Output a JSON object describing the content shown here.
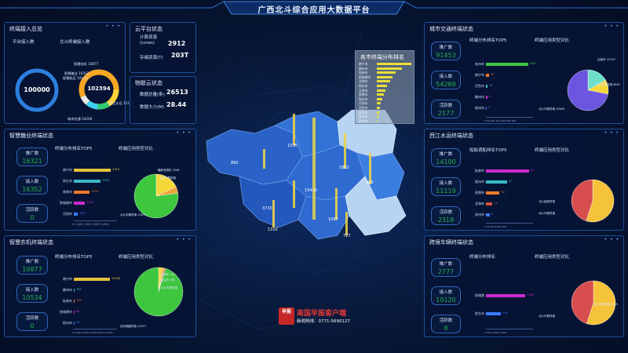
{
  "header": {
    "title": "广西北斗综合应用大数据平台"
  },
  "panel_dots": "• • •",
  "access": {
    "title": "终端接入总览",
    "platform_label": "平台接入数",
    "beidou_label": "北斗终端接入数",
    "platform_value": "100000",
    "beidou_value": "102394",
    "donut_labels": [
      "智慧农机 10877",
      "智慧糖业 16352",
      "智慧航运 10120",
      "西江水运 11119",
      "城市交通 54269"
    ]
  },
  "cloud": {
    "title": "云平台状态",
    "rows": [
      {
        "label": "计算资源(cores)",
        "value": "2912"
      },
      {
        "label": "存储资源(T)",
        "value": "203T"
      }
    ]
  },
  "iot": {
    "title": "物联云状态",
    "rows": [
      {
        "label": "数据总量(条)",
        "value": "26513"
      },
      {
        "label": "数据大小(M)",
        "value": "28.44"
      }
    ]
  },
  "sugar": {
    "title": "智慧糖业终端状态",
    "bar_title": "终端分布排名TOP5",
    "pie_title": "终端应用类型对比",
    "metrics": [
      {
        "label": "推广数",
        "value": "16321"
      },
      {
        "label": "接入数",
        "value": "16352"
      },
      {
        "label": "活跃数",
        "value": "0"
      }
    ],
    "ticks": "0  1,000  2,000  3,000  4,000",
    "pie_labels": [
      "糖蔗收割机 2946",
      "北斗车载终端",
      "北斗车载终端 12672"
    ]
  },
  "farm": {
    "title": "智慧农机终端状态",
    "bar_title": "终端分布排名TOP5",
    "pie_title": "终端应用类型对比",
    "metrics": [
      {
        "label": "推广数",
        "value": "10877"
      },
      {
        "label": "接入数",
        "value": "10534"
      },
      {
        "label": "活跃数",
        "value": "0"
      }
    ],
    "ticks": "0  2,000  4,000  6,000  8,000  10,000",
    "pie_labels": [
      "插秧机 281",
      "植保无人机",
      "北斗车载终端",
      "农机调度终端 10077"
    ]
  },
  "traffic": {
    "title": "城市交通终端状态",
    "bar_title": "终端分布排名TOP5",
    "pie_title": "终端应用类型对比",
    "metrics": [
      {
        "label": "推广数",
        "value": "91453"
      },
      {
        "label": "接入数",
        "value": "54269"
      },
      {
        "label": "活跃数",
        "value": "2177"
      }
    ],
    "ticks": "0  50  100  150  200  250  300",
    "pie_labels": [
      "出租车 10135",
      "北斗车载终端 6851",
      "北斗车载终端 43640"
    ]
  },
  "river": {
    "title": "西江水运终端状态",
    "bar_title": "船舶调船排名TOP5",
    "pie_title": "终端应用类型对比",
    "metrics": [
      {
        "label": "推广数",
        "value": "14100"
      },
      {
        "label": "接入数",
        "value": "11119"
      },
      {
        "label": "活跃数",
        "value": "2318"
      }
    ],
    "ticks": "0  20  40  60  80  100",
    "pie_labels": [
      "北斗船舶终端",
      "北斗车载终端"
    ]
  },
  "cross": {
    "title": "跨境车辆终端状态",
    "bar_title": "终端分布排名",
    "pie_title": "终端应用类型对比",
    "metrics": [
      {
        "label": "推广数",
        "value": "2777"
      },
      {
        "label": "接入数",
        "value": "10120"
      },
      {
        "label": "活跃数",
        "value": "8"
      }
    ],
    "ticks": "0  500  1,000  1,500",
    "pie_labels": [
      "北斗车载终端 2945",
      "北斗车载终端"
    ]
  },
  "map_popup": {
    "title": "各市终端分布排名",
    "items": [
      {
        "name": "南宁市",
        "v": 1.0
      },
      {
        "name": "柳州市",
        "v": 0.72
      },
      {
        "name": "桂林市",
        "v": 0.55
      },
      {
        "name": "防城港市",
        "v": 0.45
      },
      {
        "name": "北海市",
        "v": 0.38
      },
      {
        "name": "梧州市",
        "v": 0.3
      },
      {
        "name": "玉林市",
        "v": 0.24
      },
      {
        "name": "贵港市",
        "v": 0.2
      },
      {
        "name": "钦州市",
        "v": 0.16
      },
      {
        "name": "河池市",
        "v": 0.12
      },
      {
        "name": "百色市",
        "v": 0.09
      },
      {
        "name": "来宾市",
        "v": 0.07
      },
      {
        "name": "贺州市",
        "v": 0.05
      },
      {
        "name": "崇左市",
        "v": 0.03
      }
    ]
  },
  "map_values": [
    "1036",
    "1862",
    "860",
    "15430",
    "966",
    "3715",
    "1097",
    "1316",
    "727"
  ],
  "watermark": {
    "logo": "早报",
    "name": "南国早报客户端",
    "hotline": "新闻热线：0771-5690127"
  },
  "chart_data": [
    {
      "type": "bar",
      "title": "终端分布排名TOP5",
      "categories": [
        "南宁市",
        "崇左市",
        "来宾市",
        "防城港市",
        "河池市"
      ],
      "values": [
        4010,
        2900,
        1700,
        1200,
        450
      ],
      "colors": [
        "#e3c13b",
        "#3ab7c6",
        "#f07a2a",
        "#cc2bd0",
        "#3a7bff"
      ],
      "xlim": [
        0,
        4500
      ]
    },
    {
      "type": "pie",
      "title": "终端应用类型对比",
      "values": [
        2946,
        800,
        12672
      ],
      "colors": [
        "#f5d73a",
        "#f1a23a",
        "#3fc63f"
      ]
    },
    {
      "type": "bar",
      "title": "终端分布排名TOP5",
      "categories": [
        "南宁市",
        "柳州市",
        "桂林市",
        "防城港市",
        "梧州市"
      ],
      "values": [
        10408,
        180,
        130,
        80,
        40
      ],
      "colors": [
        "#e3c13b",
        "#3ab7c6",
        "#f07a2a",
        "#cc2bd0",
        "#3a7bff"
      ],
      "xlim": [
        0,
        12000
      ]
    },
    {
      "type": "pie",
      "title": "终端应用类型对比",
      "values": [
        281,
        120,
        80,
        10077
      ],
      "colors": [
        "#f5d73a",
        "#f1a23a",
        "#d84e3a",
        "#3fc63f"
      ]
    },
    {
      "type": "bar",
      "title": "终端分布排名TOP5",
      "categories": [
        "钦州市",
        "南宁市",
        "百色市",
        "柳州市",
        "梧州市"
      ],
      "values": [
        280,
        20,
        12,
        8,
        5
      ],
      "colors": [
        "#3fc63f",
        "#f07a2a",
        "#3ab7c6",
        "#cc2bd0",
        "#3a7bff"
      ],
      "xlim": [
        0,
        300
      ]
    },
    {
      "type": "pie",
      "title": "终端应用类型对比",
      "values": [
        10135,
        6851,
        43640
      ],
      "colors": [
        "#6fe0c8",
        "#f5d73a",
        "#6c55e0"
      ]
    },
    {
      "type": "bar",
      "title": "船舶调船排名TOP5",
      "categories": [
        "桂林市",
        "梧州市",
        "贵港市",
        "北海市",
        "钦州市"
      ],
      "values": [
        94,
        47,
        30,
        14,
        8
      ],
      "colors": [
        "#cc2bd0",
        "#3ab7c6",
        "#f07a2a",
        "#d84e3a",
        "#3a7bff"
      ],
      "xlim": [
        0,
        100
      ]
    },
    {
      "type": "pie",
      "title": "终端应用类型对比",
      "values": [
        55,
        45
      ],
      "colors": [
        "#f5c33a",
        "#d84e4e"
      ]
    },
    {
      "type": "bar",
      "title": "终端分布排名",
      "categories": [
        "防城港",
        "崇左市"
      ],
      "values": [
        1300,
        500
      ],
      "colors": [
        "#cc2bd0",
        "#3a7bff"
      ],
      "xlim": [
        0,
        1500
      ]
    },
    {
      "type": "pie",
      "title": "终端应用类型对比",
      "values": [
        55,
        45
      ],
      "colors": [
        "#f5c33a",
        "#d84e4e"
      ]
    }
  ]
}
